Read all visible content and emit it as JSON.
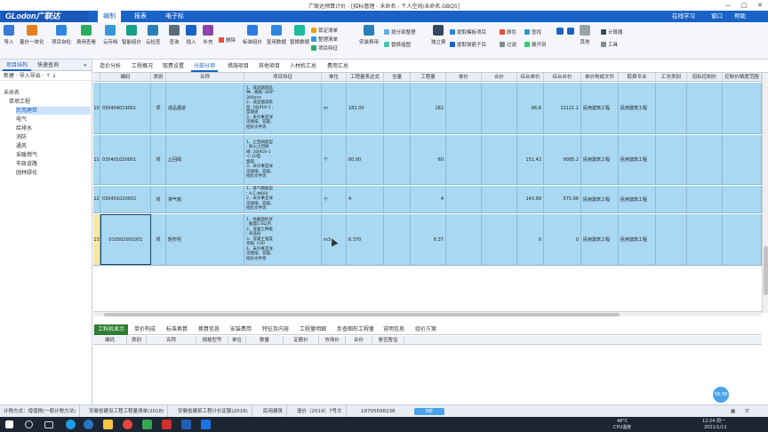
{
  "window": {
    "title": "广联达预算计价 - [招标管理 - 未命名 - 个人空间/未命名.GBQ5]",
    "controls": [
      "—",
      "□",
      "✕"
    ]
  },
  "menu": {
    "logo": "GLodon广联达",
    "items": [
      "编制",
      "报表",
      "电子标"
    ],
    "active": "编制",
    "right": [
      "在线学习",
      "窗口",
      "帮助"
    ]
  },
  "ribbon": {
    "big_buttons": [
      "导入",
      "量价一体化",
      "项目自检",
      "费用查看",
      "云存档",
      "智能组价",
      "云检查",
      "查询",
      "插入",
      "补充",
      "删除",
      "标准组价",
      "复用数据",
      "替换数据",
      "安装费用",
      "独立费",
      "颜色",
      "过滤",
      "展开到",
      "其他",
      "工具"
    ],
    "small_buttons": [
      "锁定清单",
      "整理清单",
      "项目特征",
      "按分部整理",
      "替换插图",
      "提取模板项目",
      "提取钢筋子目",
      "查找",
      "计算器",
      "工具"
    ]
  },
  "left_panel": {
    "tabs": [
      "项目结构",
      "快速查询"
    ],
    "active_tab": "项目结构",
    "toolbar": "新建 · 导入导出 · ↑ ↓",
    "tree": [
      {
        "label": "未命名",
        "level": 0
      },
      {
        "label": "单项工程",
        "level": 1
      },
      {
        "label": "民用建筑",
        "level": 2,
        "selected": true
      },
      {
        "label": "电气",
        "level": 2
      },
      {
        "label": "给排水",
        "level": 2
      },
      {
        "label": "消防",
        "level": 2
      },
      {
        "label": "通风",
        "level": 2
      },
      {
        "label": "采暖燃气",
        "level": 2
      },
      {
        "label": "市政道路",
        "level": 2
      },
      {
        "label": "园林绿化",
        "level": 2
      }
    ]
  },
  "top_tabs": [
    "造价分析",
    "工程概况",
    "取费设置",
    "分部分项",
    "措施项目",
    "其他项目",
    "人材机汇总",
    "费用汇总"
  ],
  "active_top_tab": "分部分项",
  "grid": {
    "columns": [
      "",
      "编码",
      "类别",
      "名称",
      "项目特征",
      "单位",
      "工程量表达式",
      "含量",
      "工程量",
      "单价",
      "合价",
      "综合单价",
      "综合合价",
      "单价构成文件",
      "取费专业",
      "汇总类别",
      "招标控制价",
      "控制价精度范围"
    ],
    "rows": [
      {
        "no": "10",
        "code": "030404019001",
        "type": "项",
        "name": "成品烟道",
        "feature": "1、成品烟道品\n种、规格: 400*\n300mm\n2、成品烟道类\n型: 16J916-1 ;\n型烟道\n3、未尽事宜详\n见图纸、答疑、\n招标文件等",
        "unit": "m",
        "expr": "182.00",
        "qty": "182",
        "price": "",
        "total": "",
        "unit_price": "66.6",
        "total_price": "12121.2",
        "file": "民用建筑工程",
        "major": "民用建筑工程"
      },
      {
        "no": "11",
        "code": "030401020001",
        "type": "项",
        "name": "止回阀",
        "feature": "1、止回阀类型\n: 防火止回阀\n阀: 16J916-1\n·C-10型\n烟道\n3、未尽事宜详\n见图纸、答疑、\n招标文件等",
        "unit": "个",
        "expr": "60.00",
        "qty": "60",
        "price": "",
        "total": "",
        "unit_price": "151.42",
        "total_price": "9085.2",
        "file": "民用建筑工程",
        "major": "民用建筑工程"
      },
      {
        "no": "12",
        "code": "030401020002",
        "type": "项",
        "name": "排气帽",
        "feature": "1、排气帽类型\n: A-C-Φ600\n2、未尽事宜详\n见图纸、答疑、\n招标文件等",
        "unit": "个",
        "expr": "4",
        "qty": "4",
        "price": "",
        "total": "",
        "unit_price": "143.99",
        "total_price": "575.96",
        "file": "民用建筑工程",
        "major": "民用建筑工程"
      },
      {
        "no": "13",
        "code": "010502001001",
        "type": "项",
        "name": "矩形柱",
        "feature": "1、柱截面形状\n: 截面1.6以内\n2、混凝土种类\n: 商品砼\n3、混凝土强度\n等级: C40\n4、未尽事宜详\n见图纸、答疑、\n招标文件等",
        "unit": "m3",
        "expr": "6.370",
        "qty": "6.37",
        "price": "",
        "total": "",
        "unit_price": "0",
        "total_price": "0",
        "file": "民用建筑工程",
        "major": "民用建筑工程"
      }
    ]
  },
  "bottom_tabs": [
    "工料机显示",
    "单价构成",
    "标准换算",
    "换算信息",
    "安装费用",
    "特征及内容",
    "工程量明细",
    "反查图形工程量",
    "说明信息",
    "组价方案"
  ],
  "active_bottom_tab": "工料机显示",
  "bottom_columns": [
    "编码",
    "类别",
    "名称",
    "规格型号",
    "单位",
    "数量",
    "定额价",
    "市场价",
    "合价",
    "是否暂估"
  ],
  "bubble": "00:38",
  "status": {
    "mode": "计税方式：增值税(一般计税方法)",
    "list_std": "安徽省建设工程工程量清单(2018)",
    "quota_std": "安徽省建筑工程计价定额(2018)",
    "major": "民用建筑",
    "doc": "造价〔2019〕7号文",
    "phone": "18705698238",
    "button": "8折"
  },
  "taskbar": {
    "temp": "48°C",
    "temp_label": "CPU温度",
    "time": "12:24 周一",
    "date": "2021/1/11"
  },
  "colors": {
    "brand_blue": "#1a63c6",
    "row_blue": "#a9d8f2",
    "row_marker_yellow": "#f6e7a4",
    "active_green_tab": "#2e7d32"
  }
}
